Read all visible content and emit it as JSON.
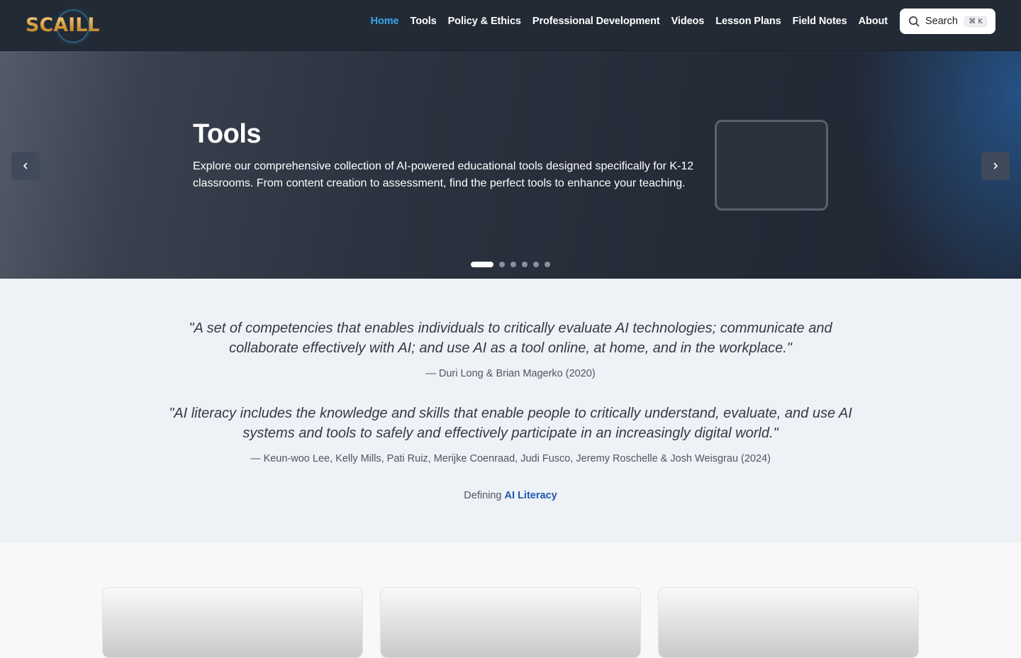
{
  "header": {
    "logo_text": "SCAILL",
    "nav": [
      {
        "label": "Home",
        "active": true
      },
      {
        "label": "Tools"
      },
      {
        "label": "Policy & Ethics"
      },
      {
        "label": "Professional Development"
      },
      {
        "label": "Videos"
      },
      {
        "label": "Lesson Plans"
      },
      {
        "label": "Field Notes"
      },
      {
        "label": "About"
      }
    ],
    "search": {
      "label": "Search",
      "shortcut": "⌘ K",
      "icon": "search-icon"
    }
  },
  "hero": {
    "title": "Tools",
    "description": "Explore our comprehensive collection of AI-powered educational tools designed specifically for K-12 classrooms. From content creation to assessment, find the perfect tools to enhance your teaching.",
    "prev_icon": "chevron-left-icon",
    "next_icon": "chevron-right-icon",
    "slide_count": 6,
    "active_slide": 1
  },
  "quotes": [
    {
      "text": "\"A set of competencies that enables individuals to critically evaluate AI technologies; communicate and collaborate effectively with AI; and use AI as a tool online, at home, and in the workplace.\"",
      "attribution": "— Duri Long & Brian Magerko (2020)"
    },
    {
      "text": "\"AI literacy includes the knowledge and skills that enable people to critically understand, evaluate, and use AI systems and tools to safely and effectively participate in an increasingly digital world.\"",
      "attribution": "— Keun-woo Lee, Kelly Mills, Pati Ruiz, Merijke Coenraad, Judi Fusco, Jeremy Roschelle & Josh Weisgrau (2024)"
    }
  ],
  "defining": {
    "prefix": "Defining",
    "link": "AI Literacy"
  },
  "colors": {
    "header_bg": "#222a36",
    "nav_active": "#3ba4ea",
    "link": "#1f57b0",
    "quotes_bg": "#eef1f6"
  }
}
